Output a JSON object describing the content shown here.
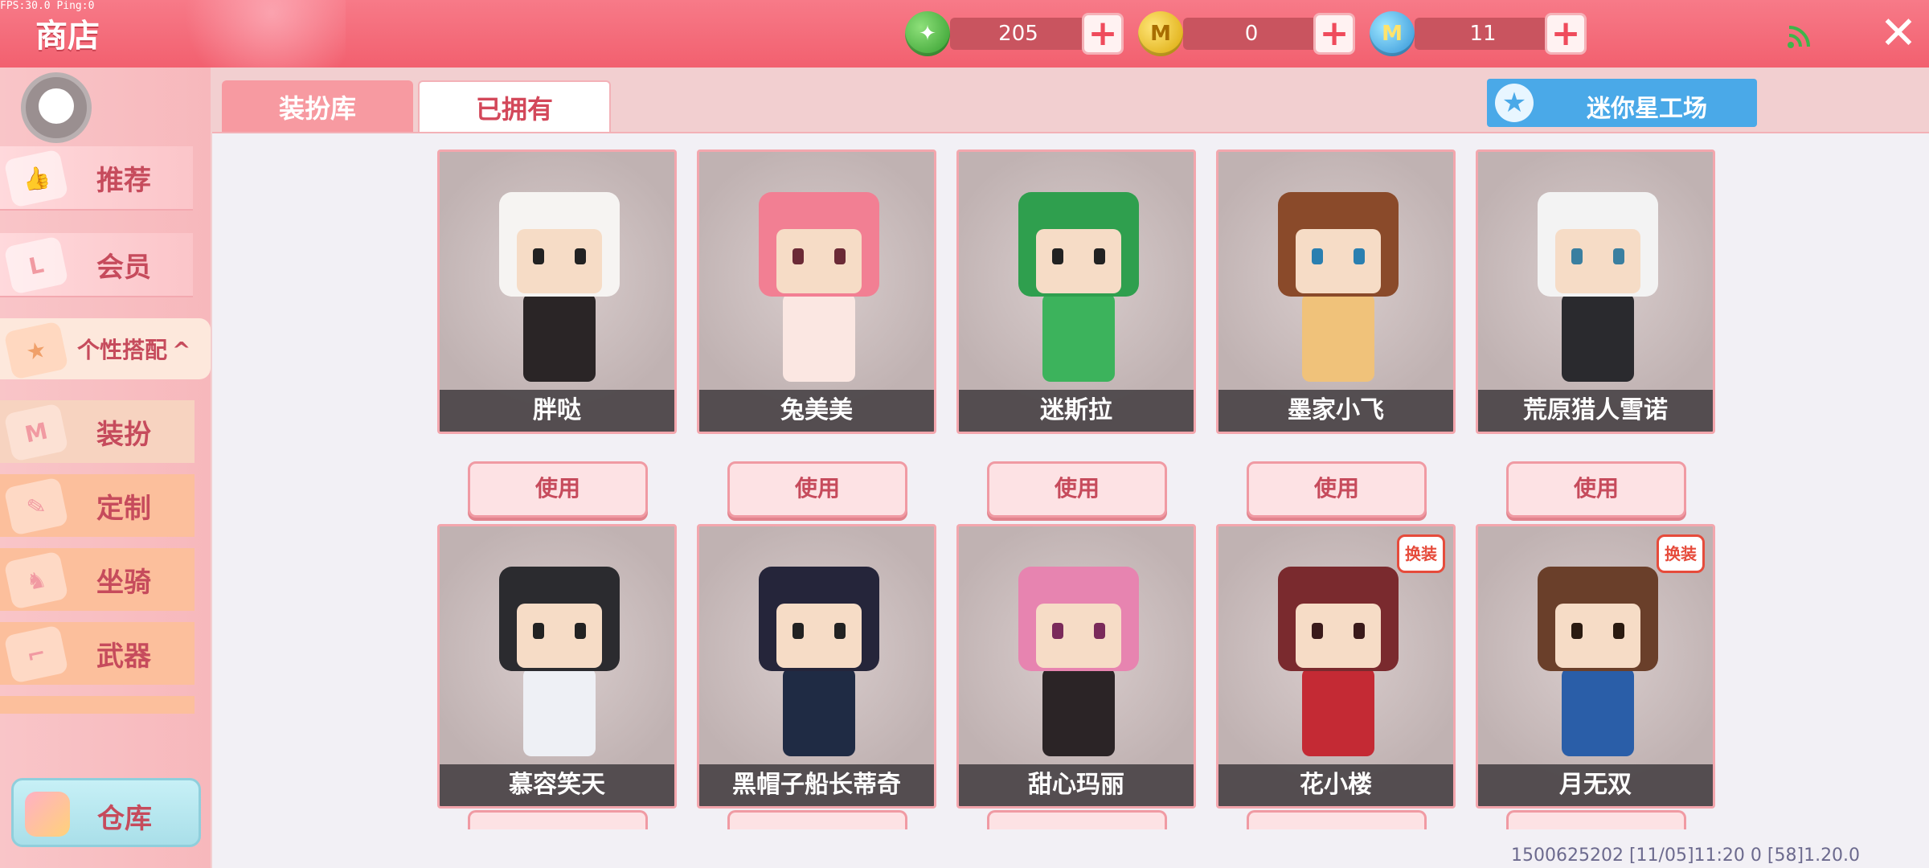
{
  "debug": "FPS:30.0  Ping:0",
  "header": {
    "title": "商店",
    "currencies": [
      {
        "icon": "green-gem-icon",
        "value": "205"
      },
      {
        "icon": "gold-coin-icon",
        "value": "0"
      },
      {
        "icon": "blue-mini-coin-icon",
        "value": "11"
      }
    ]
  },
  "sidebar": {
    "items": [
      {
        "label": "推荐",
        "icon": "thumbs-up-icon"
      },
      {
        "label": "会员",
        "icon": "vip-card-icon"
      },
      {
        "label": "个性搭配",
        "icon": "star-badge-icon",
        "arrow": "^"
      },
      {
        "label": "装扮",
        "icon": "shirt-icon"
      },
      {
        "label": "定制",
        "icon": "pencil-icon"
      },
      {
        "label": "坐骑",
        "icon": "mount-icon"
      },
      {
        "label": "武器",
        "icon": "gun-icon"
      }
    ],
    "warehouse": "仓库"
  },
  "tabs": [
    {
      "label": "装扮库"
    },
    {
      "label": "已拥有"
    }
  ],
  "workshop_label": "迷你星工场",
  "use_label": "使用",
  "skins": [
    {
      "name": "胖哒",
      "head": "#f6f4f2",
      "body": "#2a2526",
      "eye": "#222"
    },
    {
      "name": "兔美美",
      "head": "#f27f93",
      "body": "#fbe7e2",
      "eye": "#6b2a36"
    },
    {
      "name": "迷斯拉",
      "head": "#2f9f4e",
      "body": "#3cb35c",
      "eye": "#222"
    },
    {
      "name": "墨家小飞",
      "head": "#8a4a2a",
      "body": "#f0c27a",
      "eye": "#2a7fb0"
    },
    {
      "name": "荒原猎人雪诺",
      "head": "#f3f3f3",
      "body": "#2a2a2e",
      "eye": "#3a7fa0"
    },
    {
      "name": "慕容笑天",
      "head": "#2b2b2f",
      "body": "#eef0f5",
      "eye": "#222"
    },
    {
      "name": "黑帽子船长蒂奇",
      "head": "#25253a",
      "body": "#1f2b44",
      "eye": "#222"
    },
    {
      "name": "甜心玛丽",
      "head": "#e784b0",
      "body": "#2b2426",
      "eye": "#7a2a5a"
    },
    {
      "name": "花小楼",
      "head": "#7a2a2e",
      "body": "#c42a34",
      "eye": "#3a1a1a",
      "badge": "换装"
    },
    {
      "name": "月无双",
      "head": "#6a3f2a",
      "body": "#2a5ea8",
      "eye": "#2a1a10",
      "badge": "换装"
    }
  ],
  "footer": "1500625202   [11/05]11:20 0      [58]1.20.0"
}
